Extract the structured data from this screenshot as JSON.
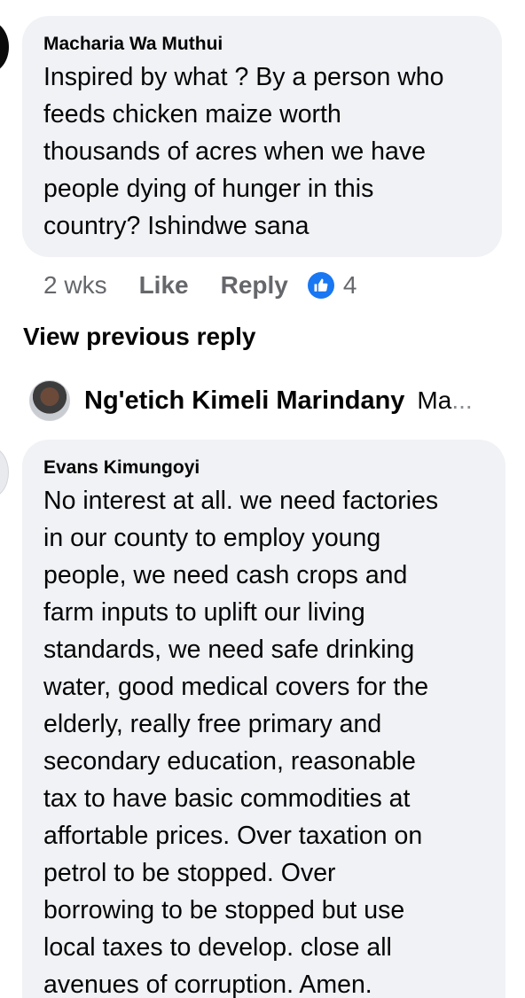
{
  "comment1": {
    "author": "Macharia Wa Muthui",
    "lines": [
      "Inspired by what ? By a person who",
      "feeds chicken maize worth",
      "thousands of acres when we have",
      "people dying of hunger in this",
      "country? Ishindwe sana"
    ],
    "time": "2 wks",
    "like_label": "Like",
    "reply_label": "Reply",
    "reaction_icon": "thumbs-up-icon",
    "reaction_count": "4",
    "reaction_color": "#1877f2"
  },
  "view_previous": "View previous reply",
  "reply_preview": {
    "name": "Ng'etich Kimeli Marindany",
    "snippet": "Ma",
    "ellipsis": "..."
  },
  "comment2": {
    "author": "Evans Kimungoyi",
    "lines": [
      "No interest at all. we need factories",
      "in our county to employ young",
      "people, we need cash crops and",
      "farm inputs to uplift our living",
      "standards, we need safe drinking",
      "water, good medical covers for the",
      "elderly, really free primary and",
      "secondary education, reasonable",
      "tax to have basic commodities at",
      "affortable prices. Over taxation on",
      "petrol to be stopped. Over",
      "borrowing to be stopped but use",
      "local taxes to develop. close all",
      "avenues of corruption.  Amen."
    ]
  }
}
